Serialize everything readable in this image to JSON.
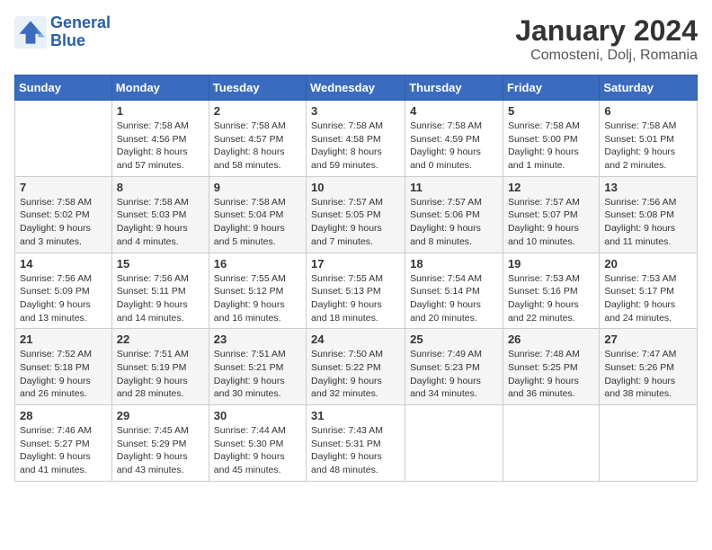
{
  "header": {
    "logo_line1": "General",
    "logo_line2": "Blue",
    "title": "January 2024",
    "subtitle": "Comosteni, Dolj, Romania"
  },
  "weekdays": [
    "Sunday",
    "Monday",
    "Tuesday",
    "Wednesday",
    "Thursday",
    "Friday",
    "Saturday"
  ],
  "weeks": [
    [
      {
        "day": "",
        "sunrise": "",
        "sunset": "",
        "daylight": ""
      },
      {
        "day": "1",
        "sunrise": "Sunrise: 7:58 AM",
        "sunset": "Sunset: 4:56 PM",
        "daylight": "Daylight: 8 hours and 57 minutes."
      },
      {
        "day": "2",
        "sunrise": "Sunrise: 7:58 AM",
        "sunset": "Sunset: 4:57 PM",
        "daylight": "Daylight: 8 hours and 58 minutes."
      },
      {
        "day": "3",
        "sunrise": "Sunrise: 7:58 AM",
        "sunset": "Sunset: 4:58 PM",
        "daylight": "Daylight: 8 hours and 59 minutes."
      },
      {
        "day": "4",
        "sunrise": "Sunrise: 7:58 AM",
        "sunset": "Sunset: 4:59 PM",
        "daylight": "Daylight: 9 hours and 0 minutes."
      },
      {
        "day": "5",
        "sunrise": "Sunrise: 7:58 AM",
        "sunset": "Sunset: 5:00 PM",
        "daylight": "Daylight: 9 hours and 1 minute."
      },
      {
        "day": "6",
        "sunrise": "Sunrise: 7:58 AM",
        "sunset": "Sunset: 5:01 PM",
        "daylight": "Daylight: 9 hours and 2 minutes."
      }
    ],
    [
      {
        "day": "7",
        "sunrise": "Sunrise: 7:58 AM",
        "sunset": "Sunset: 5:02 PM",
        "daylight": "Daylight: 9 hours and 3 minutes."
      },
      {
        "day": "8",
        "sunrise": "Sunrise: 7:58 AM",
        "sunset": "Sunset: 5:03 PM",
        "daylight": "Daylight: 9 hours and 4 minutes."
      },
      {
        "day": "9",
        "sunrise": "Sunrise: 7:58 AM",
        "sunset": "Sunset: 5:04 PM",
        "daylight": "Daylight: 9 hours and 5 minutes."
      },
      {
        "day": "10",
        "sunrise": "Sunrise: 7:57 AM",
        "sunset": "Sunset: 5:05 PM",
        "daylight": "Daylight: 9 hours and 7 minutes."
      },
      {
        "day": "11",
        "sunrise": "Sunrise: 7:57 AM",
        "sunset": "Sunset: 5:06 PM",
        "daylight": "Daylight: 9 hours and 8 minutes."
      },
      {
        "day": "12",
        "sunrise": "Sunrise: 7:57 AM",
        "sunset": "Sunset: 5:07 PM",
        "daylight": "Daylight: 9 hours and 10 minutes."
      },
      {
        "day": "13",
        "sunrise": "Sunrise: 7:56 AM",
        "sunset": "Sunset: 5:08 PM",
        "daylight": "Daylight: 9 hours and 11 minutes."
      }
    ],
    [
      {
        "day": "14",
        "sunrise": "Sunrise: 7:56 AM",
        "sunset": "Sunset: 5:09 PM",
        "daylight": "Daylight: 9 hours and 13 minutes."
      },
      {
        "day": "15",
        "sunrise": "Sunrise: 7:56 AM",
        "sunset": "Sunset: 5:11 PM",
        "daylight": "Daylight: 9 hours and 14 minutes."
      },
      {
        "day": "16",
        "sunrise": "Sunrise: 7:55 AM",
        "sunset": "Sunset: 5:12 PM",
        "daylight": "Daylight: 9 hours and 16 minutes."
      },
      {
        "day": "17",
        "sunrise": "Sunrise: 7:55 AM",
        "sunset": "Sunset: 5:13 PM",
        "daylight": "Daylight: 9 hours and 18 minutes."
      },
      {
        "day": "18",
        "sunrise": "Sunrise: 7:54 AM",
        "sunset": "Sunset: 5:14 PM",
        "daylight": "Daylight: 9 hours and 20 minutes."
      },
      {
        "day": "19",
        "sunrise": "Sunrise: 7:53 AM",
        "sunset": "Sunset: 5:16 PM",
        "daylight": "Daylight: 9 hours and 22 minutes."
      },
      {
        "day": "20",
        "sunrise": "Sunrise: 7:53 AM",
        "sunset": "Sunset: 5:17 PM",
        "daylight": "Daylight: 9 hours and 24 minutes."
      }
    ],
    [
      {
        "day": "21",
        "sunrise": "Sunrise: 7:52 AM",
        "sunset": "Sunset: 5:18 PM",
        "daylight": "Daylight: 9 hours and 26 minutes."
      },
      {
        "day": "22",
        "sunrise": "Sunrise: 7:51 AM",
        "sunset": "Sunset: 5:19 PM",
        "daylight": "Daylight: 9 hours and 28 minutes."
      },
      {
        "day": "23",
        "sunrise": "Sunrise: 7:51 AM",
        "sunset": "Sunset: 5:21 PM",
        "daylight": "Daylight: 9 hours and 30 minutes."
      },
      {
        "day": "24",
        "sunrise": "Sunrise: 7:50 AM",
        "sunset": "Sunset: 5:22 PM",
        "daylight": "Daylight: 9 hours and 32 minutes."
      },
      {
        "day": "25",
        "sunrise": "Sunrise: 7:49 AM",
        "sunset": "Sunset: 5:23 PM",
        "daylight": "Daylight: 9 hours and 34 minutes."
      },
      {
        "day": "26",
        "sunrise": "Sunrise: 7:48 AM",
        "sunset": "Sunset: 5:25 PM",
        "daylight": "Daylight: 9 hours and 36 minutes."
      },
      {
        "day": "27",
        "sunrise": "Sunrise: 7:47 AM",
        "sunset": "Sunset: 5:26 PM",
        "daylight": "Daylight: 9 hours and 38 minutes."
      }
    ],
    [
      {
        "day": "28",
        "sunrise": "Sunrise: 7:46 AM",
        "sunset": "Sunset: 5:27 PM",
        "daylight": "Daylight: 9 hours and 41 minutes."
      },
      {
        "day": "29",
        "sunrise": "Sunrise: 7:45 AM",
        "sunset": "Sunset: 5:29 PM",
        "daylight": "Daylight: 9 hours and 43 minutes."
      },
      {
        "day": "30",
        "sunrise": "Sunrise: 7:44 AM",
        "sunset": "Sunset: 5:30 PM",
        "daylight": "Daylight: 9 hours and 45 minutes."
      },
      {
        "day": "31",
        "sunrise": "Sunrise: 7:43 AM",
        "sunset": "Sunset: 5:31 PM",
        "daylight": "Daylight: 9 hours and 48 minutes."
      },
      {
        "day": "",
        "sunrise": "",
        "sunset": "",
        "daylight": ""
      },
      {
        "day": "",
        "sunrise": "",
        "sunset": "",
        "daylight": ""
      },
      {
        "day": "",
        "sunrise": "",
        "sunset": "",
        "daylight": ""
      }
    ]
  ]
}
